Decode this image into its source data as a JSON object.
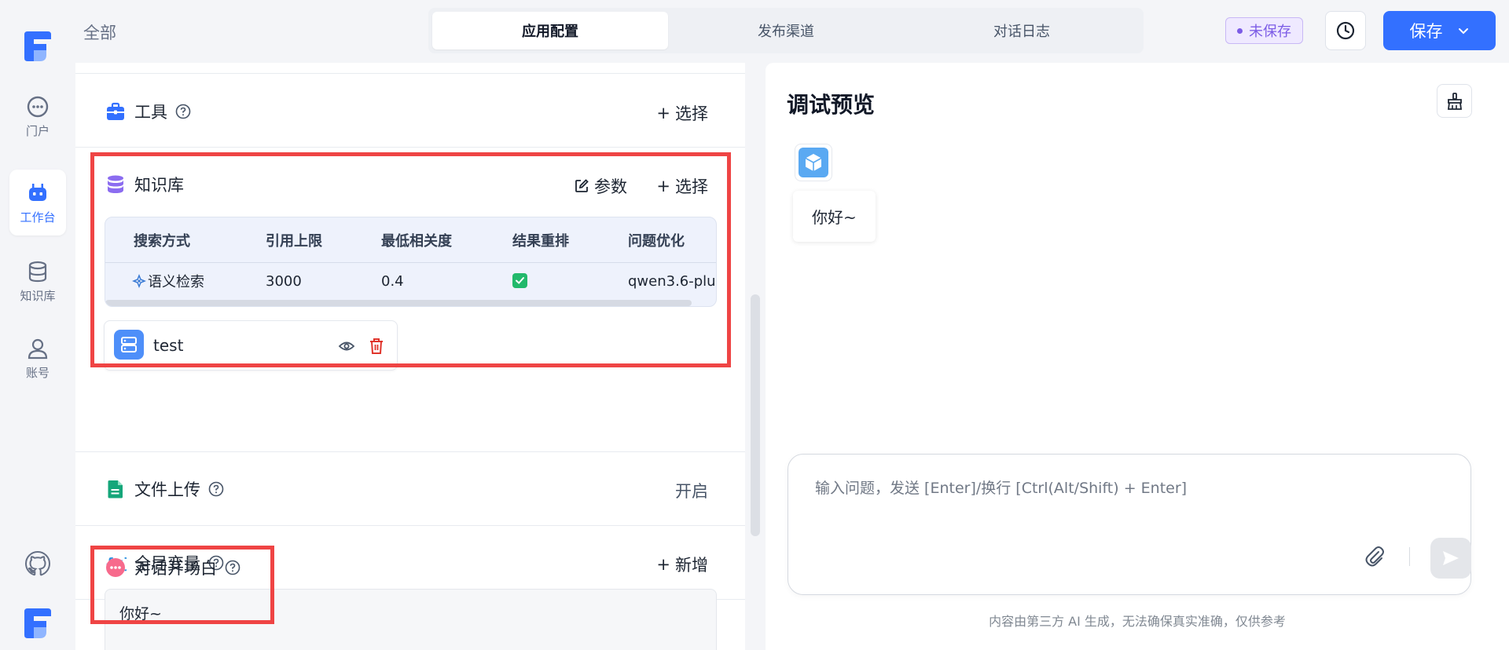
{
  "rail": {
    "items": [
      {
        "label": "门户"
      },
      {
        "label": "工作台"
      },
      {
        "label": "知识库"
      },
      {
        "label": "账号"
      }
    ]
  },
  "topbar": {
    "breadcrumb": "全部",
    "tabs": [
      {
        "label": "应用配置",
        "active": true
      },
      {
        "label": "发布渠道",
        "active": false
      },
      {
        "label": "对话日志",
        "active": false
      }
    ],
    "unsaved_label": "未保存",
    "save_label": "保存"
  },
  "config": {
    "tools": {
      "title": "工具",
      "action": "选择"
    },
    "knowledge": {
      "title": "知识库",
      "param_label": "参数",
      "action": "选择",
      "table": {
        "headers": [
          "搜索方式",
          "引用上限",
          "最低相关度",
          "结果重排",
          "问题优化"
        ],
        "row": {
          "search_mode": "语义检索",
          "limit": "3000",
          "min_score": "0.4",
          "rerank": true,
          "optimizer": "qwen3.6-plus"
        }
      },
      "datasets": [
        {
          "name": "test"
        }
      ]
    },
    "file_upload": {
      "title": "文件上传",
      "value": "开启"
    },
    "variables": {
      "title": "全局变量",
      "action": "新增"
    },
    "opener": {
      "title": "对话开场白",
      "text": "你好~"
    }
  },
  "preview": {
    "title": "调试预览",
    "welcome": "你好~",
    "input_placeholder": "输入问题，发送 [Enter]/换行 [Ctrl(Alt/Shift) + Enter]",
    "disclaimer": "内容由第三方 AI 生成，无法确保真实准确，仅供参考"
  },
  "colors": {
    "accent": "#3370ff",
    "highlight": "#ef4444",
    "unsaved": "#7c5ce6",
    "success": "#22b96b"
  }
}
